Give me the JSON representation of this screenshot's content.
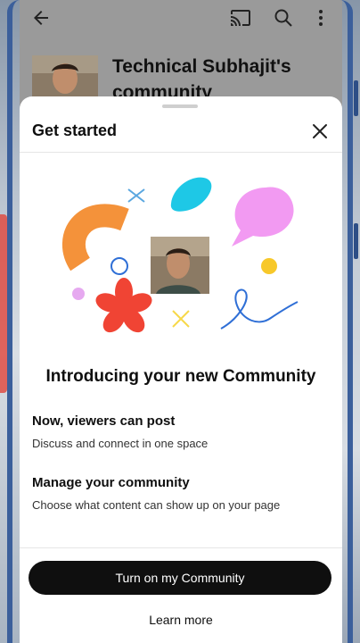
{
  "background_app": {
    "channel_title": "Technical Subhajit's community",
    "icons": [
      "back-arrow-icon",
      "cast-icon",
      "search-icon",
      "more-vert-icon"
    ]
  },
  "sheet": {
    "title": "Get started",
    "close_icon": "close-icon",
    "heading": "Introducing your new Community",
    "features": [
      {
        "title": "Now, viewers can post",
        "description": "Discuss and connect in one space"
      },
      {
        "title": "Manage your community",
        "description": "Choose what content can show up on your page"
      }
    ],
    "primary_button_label": "Turn on my Community",
    "secondary_button_label": "Learn more"
  },
  "colors": {
    "primary_button_bg": "#0f0f0f",
    "orange_shape": "#f4923a",
    "cyan_shape": "#1ec8e6",
    "pink_bubble": "#f29af2",
    "red_flower": "#f04434",
    "yellow_dot": "#f7c82a",
    "blue_line": "#2f6fd6"
  }
}
